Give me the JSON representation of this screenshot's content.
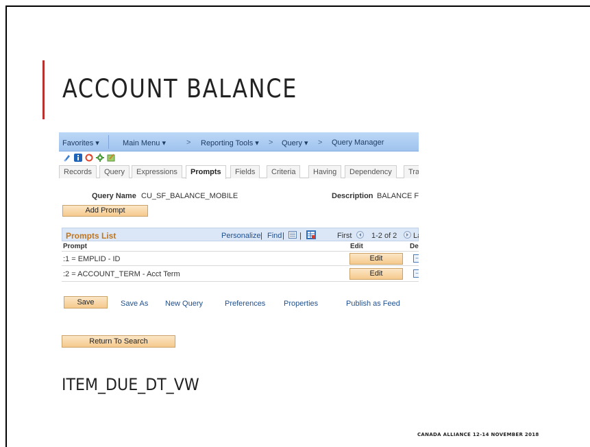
{
  "slide": {
    "title": "ACCOUNT BALANCE",
    "bottom_label": "ITEM_DUE_DT_VW",
    "footer": "CANADA ALLIANCE   12-14 NOVEMBER 2018",
    "accent_color": "#b8312f"
  },
  "navbar": {
    "items": [
      "Favorites ▾",
      "Main Menu ▾",
      "Reporting Tools ▾",
      "Query ▾",
      "Query Manager"
    ],
    "separator": ">"
  },
  "toolbar_icons": [
    "help-icon",
    "info-icon",
    "refresh-icon",
    "settings-icon",
    "edit-icon"
  ],
  "tabs": [
    {
      "label": "Records",
      "active": false
    },
    {
      "label": "Query",
      "active": false
    },
    {
      "label": "Expressions",
      "active": false
    },
    {
      "label": "Prompts",
      "active": true
    },
    {
      "label": "Fields",
      "active": false
    },
    {
      "label": "Criteria",
      "active": false
    },
    {
      "label": "Having",
      "active": false
    },
    {
      "label": "Dependency",
      "active": false
    },
    {
      "label": "Tra",
      "active": false
    }
  ],
  "query": {
    "name_label": "Query Name",
    "name_value": "CU_SF_BALANCE_MOBILE",
    "description_label": "Description",
    "description_value": "BALANCE FO"
  },
  "buttons": {
    "add_prompt": "Add Prompt",
    "save": "Save",
    "return_to_search": "Return To Search"
  },
  "prompts_list": {
    "title": "Prompts List",
    "personalize": "Personalize",
    "find": "Find",
    "first": "First",
    "range": "1-2 of 2",
    "last": "La",
    "columns": [
      "Prompt",
      "Edit",
      "Del"
    ],
    "rows": [
      {
        "prompt": ":1 = EMPLID - ID",
        "edit": "Edit"
      },
      {
        "prompt": ":2 = ACCOUNT_TERM - Acct Term",
        "edit": "Edit"
      }
    ]
  },
  "links": [
    "Save As",
    "New Query",
    "Preferences",
    "Properties",
    "Publish as Feed"
  ]
}
